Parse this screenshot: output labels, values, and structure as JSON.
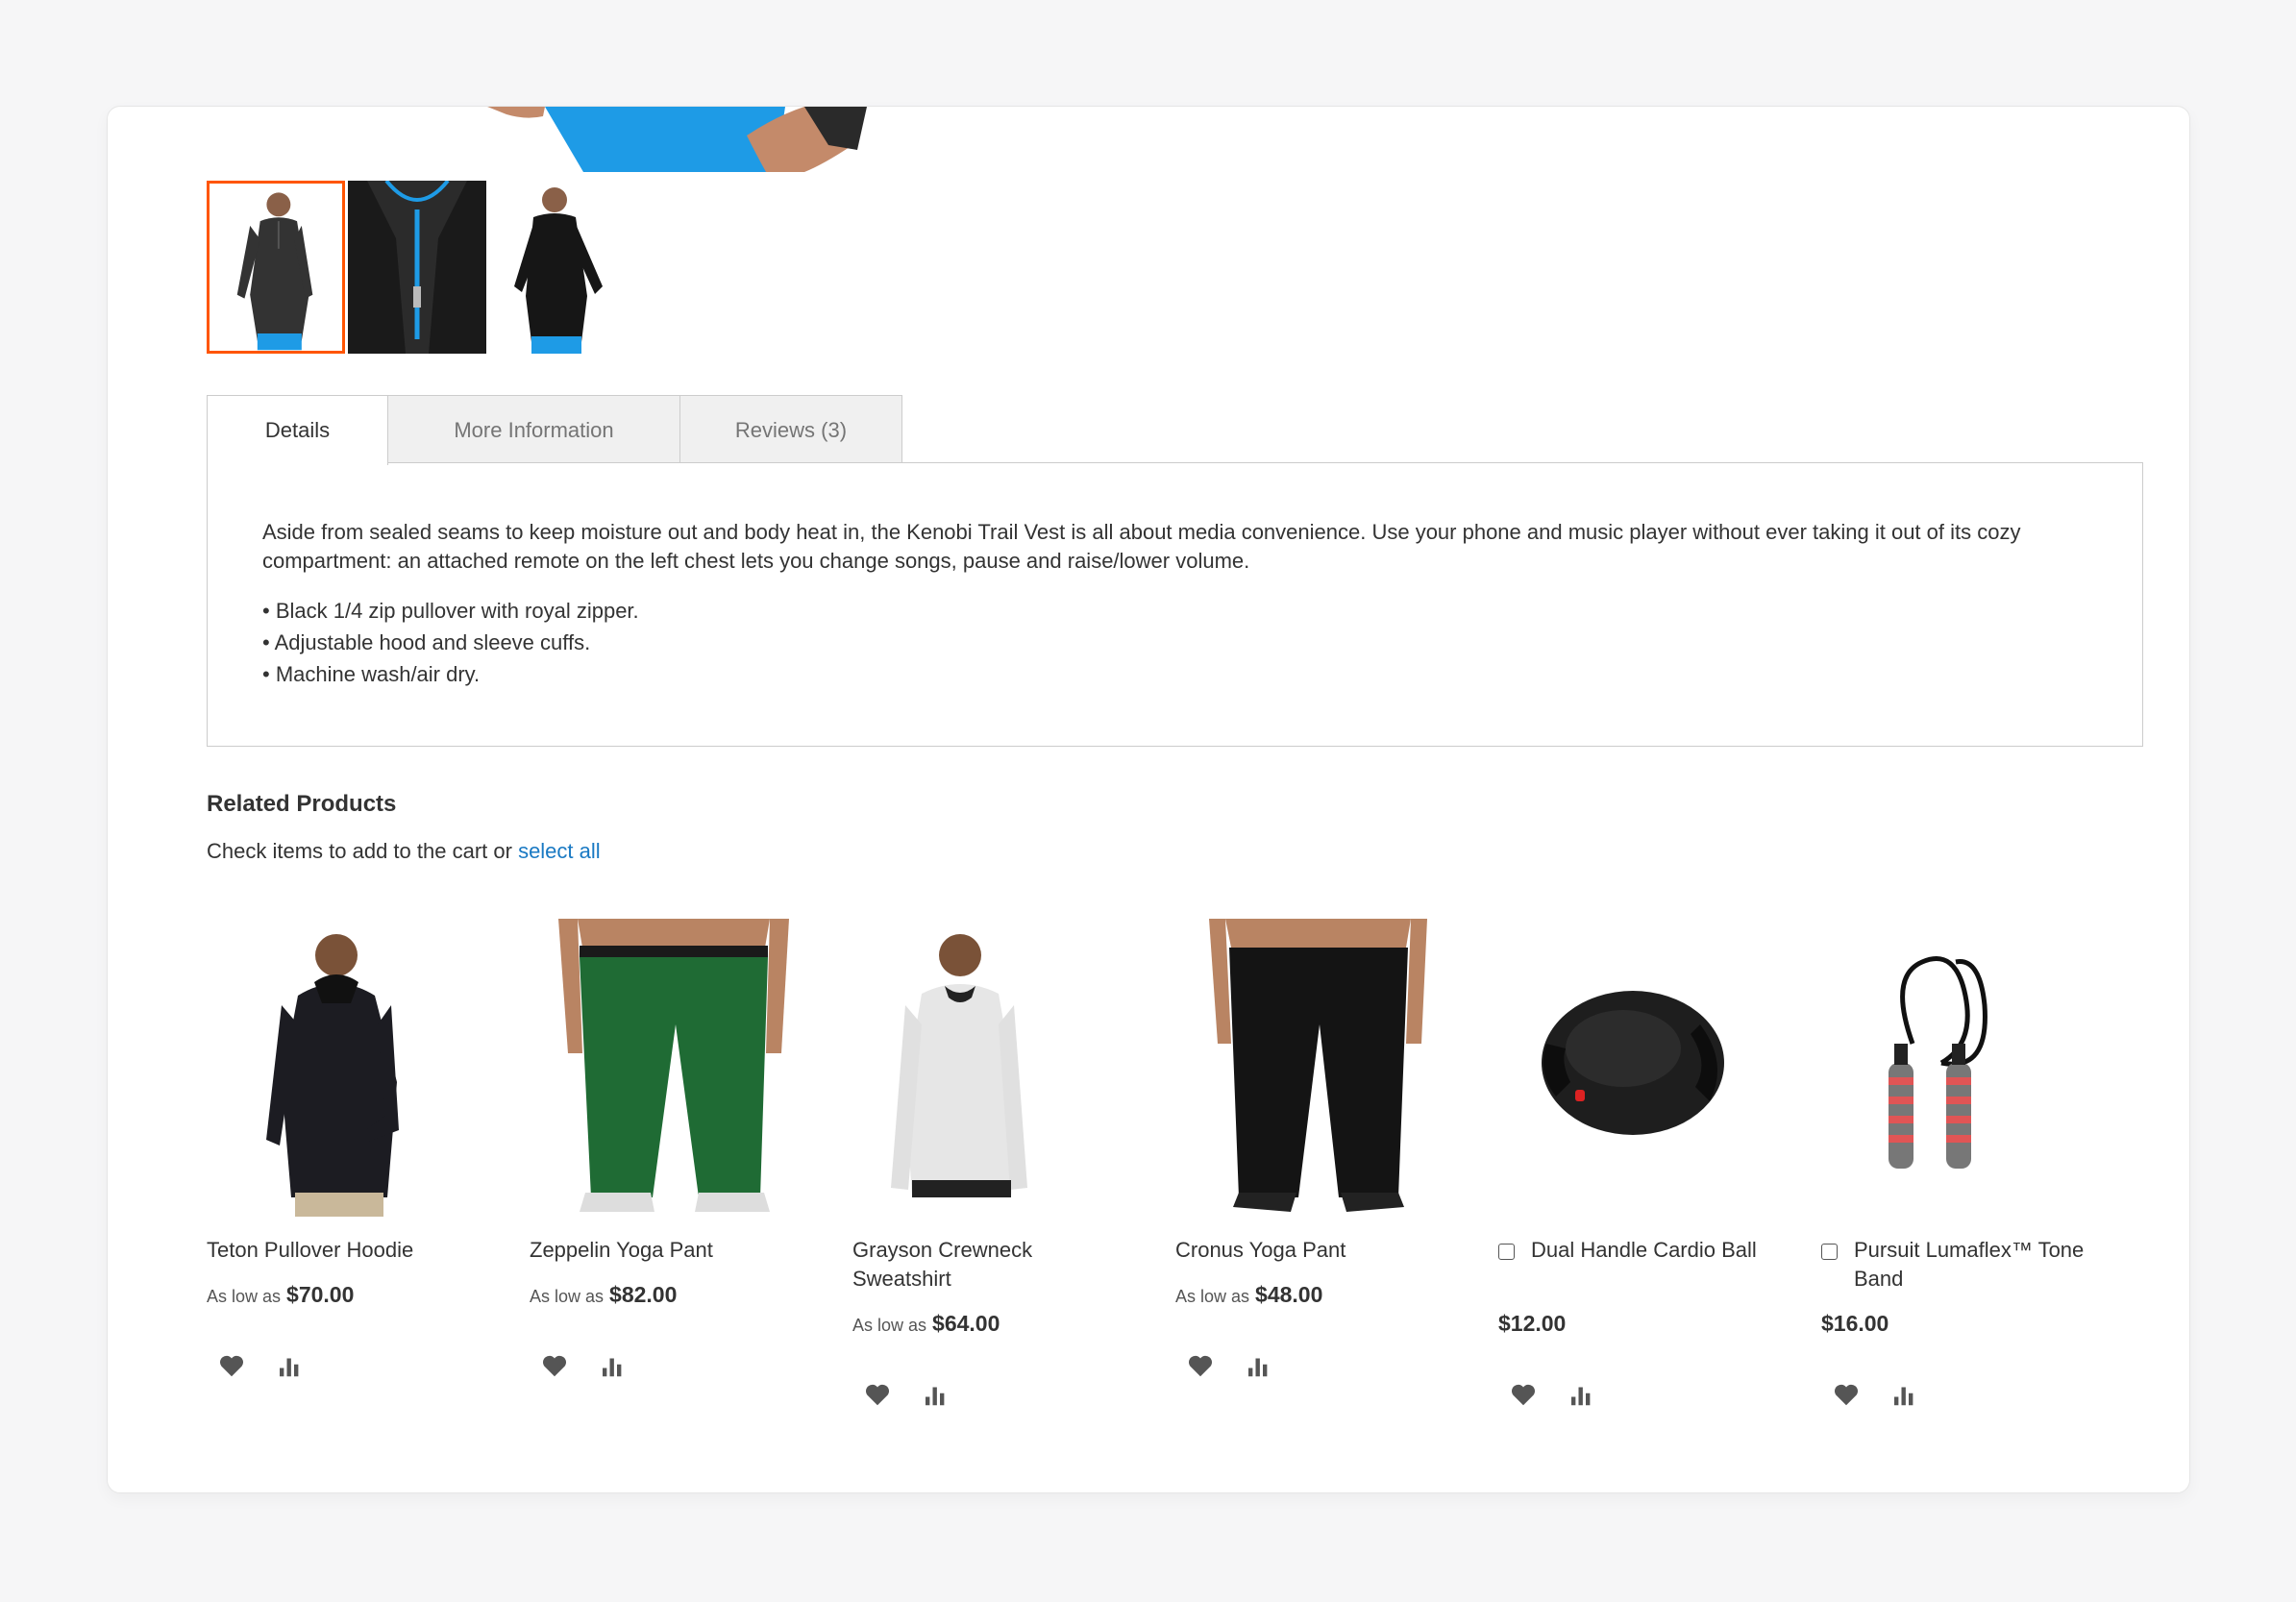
{
  "gallery": {
    "thumbnails": [
      {
        "alt": "front"
      },
      {
        "alt": "zipper"
      },
      {
        "alt": "back"
      }
    ]
  },
  "tabs": [
    {
      "label": "Details",
      "active": true
    },
    {
      "label": "More Information",
      "active": false
    },
    {
      "label": "Reviews (3)",
      "active": false
    }
  ],
  "details": {
    "description": "Aside from sealed seams to keep moisture out and body heat in, the Kenobi Trail Vest is all about media convenience. Use your phone and music player without ever taking it out of its cozy compartment: an attached remote on the left chest lets you change songs, pause and raise/lower volume.",
    "bullets": [
      "• Black 1/4 zip pullover with royal zipper.",
      "• Adjustable hood and sleeve cuffs.",
      "• Machine wash/air dry."
    ]
  },
  "related": {
    "title": "Related Products",
    "note_prefix": "Check items to add to the cart or",
    "select_all": "select all",
    "products": [
      {
        "name": "Teton Pullover Hoodie",
        "price_label": "As low as",
        "price": "$70.00",
        "has_checkbox": false
      },
      {
        "name": "Zeppelin Yoga Pant",
        "price_label": "As low as",
        "price": "$82.00",
        "has_checkbox": false
      },
      {
        "name": "Grayson Crewneck Sweatshirt",
        "price_label": "As low as",
        "price": "$64.00",
        "has_checkbox": false
      },
      {
        "name": "Cronus Yoga Pant",
        "price_label": "As low as",
        "price": "$48.00",
        "has_checkbox": false
      },
      {
        "name": "Dual Handle Cardio Ball",
        "price_label": "",
        "price": "$12.00",
        "has_checkbox": true
      },
      {
        "name": "Pursuit Lumaflex™ Tone Band",
        "price_label": "",
        "price": "$16.00",
        "has_checkbox": true
      }
    ],
    "icons": {
      "wishlist": "heart-icon",
      "compare": "compare-bars-icon"
    }
  },
  "colors": {
    "accent": "#ff5501",
    "link": "#1979c3",
    "blue_product": "#1e9be6"
  }
}
